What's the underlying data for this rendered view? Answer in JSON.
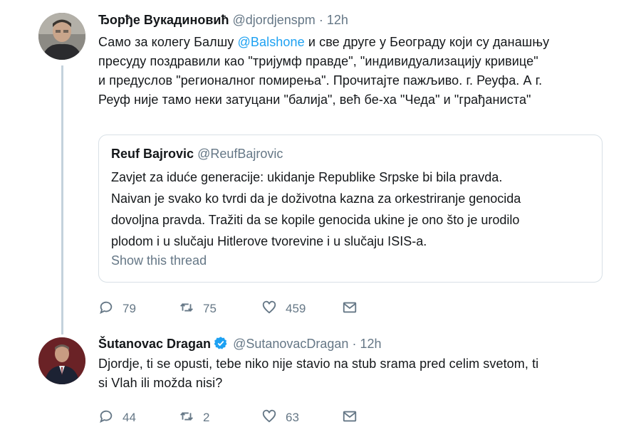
{
  "tweet1": {
    "name": "Ђорђе Вукадиновић",
    "handle": "@djordjenspm",
    "dot": "·",
    "time": "12h",
    "text_before_mention": "Само за колегу Балшу ",
    "mention": "@Balshone",
    "text_after_mention_lines": [
      " и све друге у Београду који су данашњу",
      "пресуду поздравили као \"тријумф правде\", \"индивидуализацију кривице\"",
      "и предуслов \"регионалног помирења\". Прочитајте пажљиво. г. Реуфа. А г.",
      "Реуф није тамо неки затуцани \"балија\", већ бе-ха \"Чеда\" и \"грађаниста\""
    ],
    "quote": {
      "name": "Reuf Bajrovic",
      "handle": "@ReufBajrovic",
      "lines": [
        "Zavjet za iduće generacije: ukidanje Republike Srpske bi bila pravda.",
        "Naivan je svako ko tvrdi da je doživotna kazna za orkestriranje genocida",
        "dovoljna pravda. Tražiti da se kopile genocida ukine je ono što je urodilo",
        "plodom i u slučaju Hitlerove tvorevine i u slučaju ISIS-a."
      ],
      "show_thread": "Show this thread"
    },
    "actions": {
      "replies": "79",
      "retweets": "75",
      "likes": "459"
    }
  },
  "tweet2": {
    "name": "Šutanovac Dragan",
    "handle": "@SutanovacDragan",
    "dot": "·",
    "time": "12h",
    "lines": [
      "Djordje, ti se opusti, tebe niko nije stavio na stub srama pred celim svetom, ti",
      "si Vlah ili možda nisi?"
    ],
    "actions": {
      "replies": "44",
      "retweets": "2",
      "likes": "63"
    }
  },
  "icons": {
    "reply": "reply-icon",
    "retweet": "retweet-icon",
    "like": "heart-icon",
    "dm": "envelope-icon",
    "verified": "verified-badge-icon"
  },
  "colors": {
    "link": "#1da1f2",
    "secondary_text": "#657786",
    "thread_line": "#c4d2dc",
    "verified": "#1da1f2"
  }
}
